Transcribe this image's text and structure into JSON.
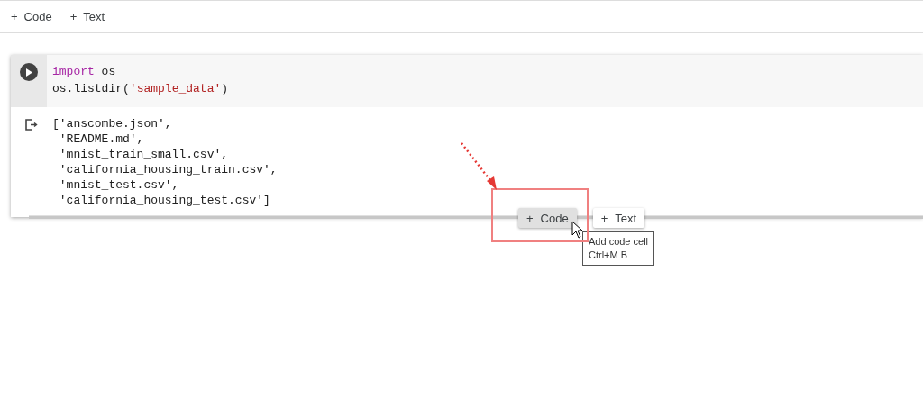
{
  "toolbar": [
    {
      "icon": "+",
      "label": "Code"
    },
    {
      "icon": "+",
      "label": "Text"
    }
  ],
  "cell": {
    "code": [
      [
        {
          "text": "import",
          "kind": "keyword"
        },
        {
          "text": " os",
          "kind": "plain"
        }
      ],
      [
        {
          "text": "os.listdir(",
          "kind": "plain"
        },
        {
          "text": "'sample_data'",
          "kind": "string"
        },
        {
          "text": ")",
          "kind": "plain"
        }
      ]
    ],
    "output": [
      "['anscombe.json',",
      " 'README.md',",
      " 'mnist_train_small.csv',",
      " 'california_housing_train.csv',",
      " 'mnist_test.csv',",
      " 'california_housing_test.csv']"
    ]
  },
  "insert_bar": [
    {
      "icon": "+",
      "label": "Code",
      "hovered": true
    },
    {
      "icon": "+",
      "label": "Text",
      "hovered": false
    }
  ],
  "tooltip": [
    "Add code cell",
    "Ctrl+M B"
  ]
}
